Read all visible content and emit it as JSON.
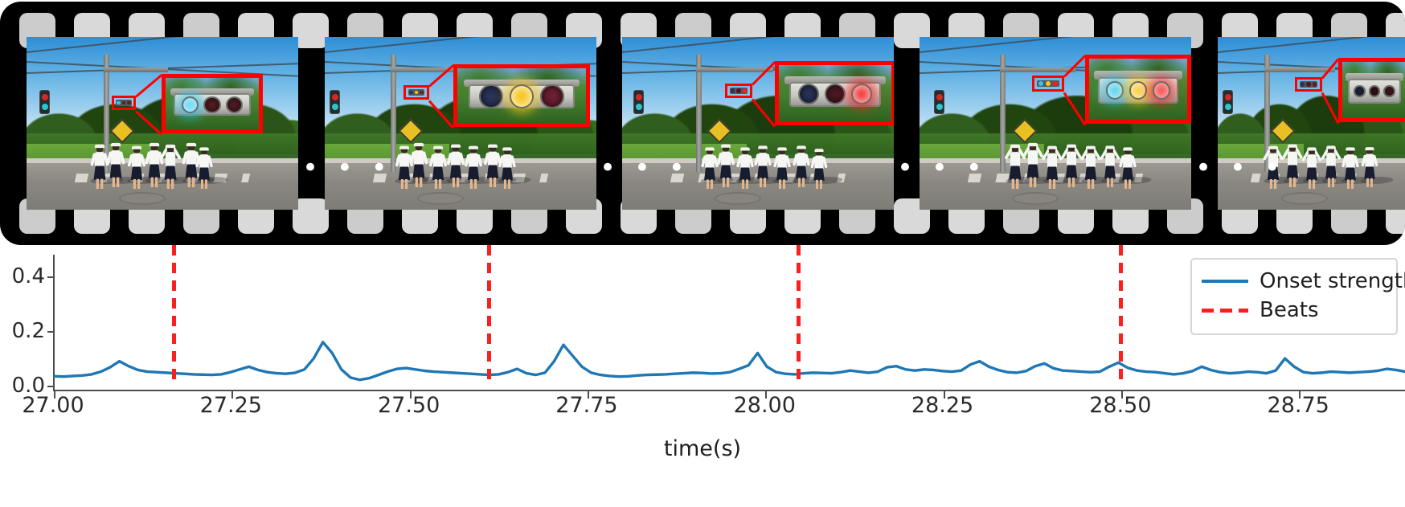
{
  "figure": {
    "title": "",
    "filmstrip": {
      "ellipsis_glyph": "• • •",
      "frames": [
        {
          "id": "frame-1",
          "caption": "",
          "traffic_light": {
            "left": "cyan",
            "middle": "off",
            "right": "off"
          },
          "lamp_colors": {
            "left": "#2fc8f0",
            "middle": "#5a1f26",
            "right": "#5a1f26"
          }
        },
        {
          "id": "frame-2",
          "caption": "",
          "traffic_light": {
            "left": "off",
            "middle": "amber",
            "right": "off"
          },
          "lamp_colors": {
            "left": "#2a3358",
            "middle": "#f5c518",
            "right": "#6a2030"
          }
        },
        {
          "id": "frame-3",
          "caption": "",
          "traffic_light": {
            "left": "off",
            "middle": "off",
            "right": "red"
          },
          "lamp_colors": {
            "left": "#2a3358",
            "middle": "#4d1a24",
            "right": "#f02020"
          }
        },
        {
          "id": "frame-4",
          "caption": "",
          "traffic_light": {
            "left": "cyan",
            "middle": "amber",
            "right": "red"
          },
          "lamp_colors": {
            "left": "#2fc8f0",
            "middle": "#f5c518",
            "right": "#f02020"
          }
        },
        {
          "id": "frame-5",
          "caption": "",
          "traffic_light": {
            "left": "off",
            "middle": "off",
            "right": "off"
          },
          "lamp_colors": {
            "left": "#2a3358",
            "middle": "#4d1a24",
            "right": "#5a1f26"
          }
        }
      ]
    }
  },
  "chart_data": {
    "type": "line",
    "title": "",
    "xlabel": "time(s)",
    "ylabel": "",
    "xlim": [
      27.0,
      28.9
    ],
    "ylim": [
      -0.02,
      0.48
    ],
    "grid": false,
    "legend_position": "upper right",
    "xticks": [
      27.0,
      27.25,
      27.5,
      27.75,
      28.0,
      28.25,
      28.5,
      28.75
    ],
    "xtick_labels": [
      "27.00",
      "27.25",
      "27.50",
      "27.75",
      "28.00",
      "28.25",
      "28.50",
      "28.75"
    ],
    "yticks": [
      0.0,
      0.2,
      0.4
    ],
    "ytick_labels": [
      "0.0",
      "0.2",
      "0.4"
    ],
    "series": [
      {
        "name": "Onset strength",
        "type": "line",
        "color": "#1f77b4",
        "linestyle": "solid",
        "x": [
          27.0,
          27.013,
          27.026,
          27.039,
          27.052,
          27.065,
          27.078,
          27.091,
          27.104,
          27.117,
          27.13,
          27.143,
          27.156,
          27.169,
          27.182,
          27.195,
          27.208,
          27.221,
          27.234,
          27.247,
          27.26,
          27.273,
          27.286,
          27.299,
          27.312,
          27.325,
          27.338,
          27.351,
          27.364,
          27.377,
          27.39,
          27.403,
          27.416,
          27.429,
          27.442,
          27.455,
          27.468,
          27.481,
          27.494,
          27.507,
          27.52,
          27.533,
          27.546,
          27.559,
          27.572,
          27.585,
          27.598,
          27.611,
          27.624,
          27.637,
          27.65,
          27.663,
          27.676,
          27.689,
          27.702,
          27.715,
          27.728,
          27.741,
          27.754,
          27.767,
          27.78,
          27.793,
          27.806,
          27.819,
          27.832,
          27.845,
          27.858,
          27.871,
          27.884,
          27.897,
          27.91,
          27.923,
          27.936,
          27.949,
          27.962,
          27.975,
          27.988,
          28.001,
          28.014,
          28.027,
          28.04,
          28.053,
          28.066,
          28.079,
          28.092,
          28.105,
          28.118,
          28.131,
          28.144,
          28.157,
          28.17,
          28.183,
          28.196,
          28.209,
          28.222,
          28.235,
          28.248,
          28.261,
          28.274,
          28.287,
          28.3,
          28.313,
          28.326,
          28.339,
          28.352,
          28.365,
          28.378,
          28.391,
          28.404,
          28.417,
          28.43,
          28.443,
          28.456,
          28.469,
          28.482,
          28.495,
          28.508,
          28.521,
          28.534,
          28.547,
          28.56,
          28.573,
          28.586,
          28.599,
          28.612,
          28.625,
          28.638,
          28.651,
          28.664,
          28.677,
          28.69,
          28.703,
          28.716,
          28.729,
          28.742,
          28.755,
          28.768,
          28.781,
          28.794,
          28.807,
          28.82,
          28.833,
          28.846,
          28.859,
          28.872,
          28.885,
          28.898
        ],
        "y": [
          0.035,
          0.034,
          0.036,
          0.038,
          0.042,
          0.052,
          0.068,
          0.09,
          0.072,
          0.058,
          0.052,
          0.05,
          0.048,
          0.046,
          0.044,
          0.042,
          0.041,
          0.04,
          0.042,
          0.05,
          0.06,
          0.07,
          0.058,
          0.05,
          0.046,
          0.044,
          0.048,
          0.06,
          0.1,
          0.16,
          0.12,
          0.06,
          0.03,
          0.022,
          0.028,
          0.04,
          0.052,
          0.062,
          0.065,
          0.06,
          0.055,
          0.052,
          0.05,
          0.048,
          0.046,
          0.044,
          0.042,
          0.04,
          0.042,
          0.05,
          0.062,
          0.046,
          0.04,
          0.048,
          0.09,
          0.15,
          0.11,
          0.07,
          0.048,
          0.04,
          0.036,
          0.034,
          0.035,
          0.038,
          0.04,
          0.041,
          0.042,
          0.044,
          0.046,
          0.048,
          0.047,
          0.045,
          0.046,
          0.05,
          0.062,
          0.075,
          0.12,
          0.07,
          0.05,
          0.044,
          0.042,
          0.046,
          0.048,
          0.047,
          0.046,
          0.05,
          0.056,
          0.052,
          0.048,
          0.052,
          0.068,
          0.072,
          0.06,
          0.056,
          0.06,
          0.058,
          0.054,
          0.052,
          0.056,
          0.078,
          0.09,
          0.07,
          0.058,
          0.05,
          0.048,
          0.054,
          0.072,
          0.082,
          0.064,
          0.056,
          0.054,
          0.052,
          0.05,
          0.052,
          0.07,
          0.085,
          0.066,
          0.056,
          0.052,
          0.05,
          0.046,
          0.042,
          0.046,
          0.054,
          0.07,
          0.058,
          0.05,
          0.046,
          0.048,
          0.052,
          0.05,
          0.046,
          0.056,
          0.1,
          0.07,
          0.05,
          0.046,
          0.048,
          0.052,
          0.05,
          0.048,
          0.05,
          0.052,
          0.055,
          0.062,
          0.058,
          0.052
        ]
      },
      {
        "name": "Beats",
        "type": "vline",
        "color": "#fb2020",
        "linestyle": "dashed",
        "x": [
          27.168,
          27.61,
          28.045,
          28.498
        ]
      }
    ],
    "legend": [
      {
        "label": "Onset strength",
        "color": "#1f77b4",
        "style": "solid"
      },
      {
        "label": "Beats",
        "color": "#fb2020",
        "style": "dashed"
      }
    ]
  }
}
